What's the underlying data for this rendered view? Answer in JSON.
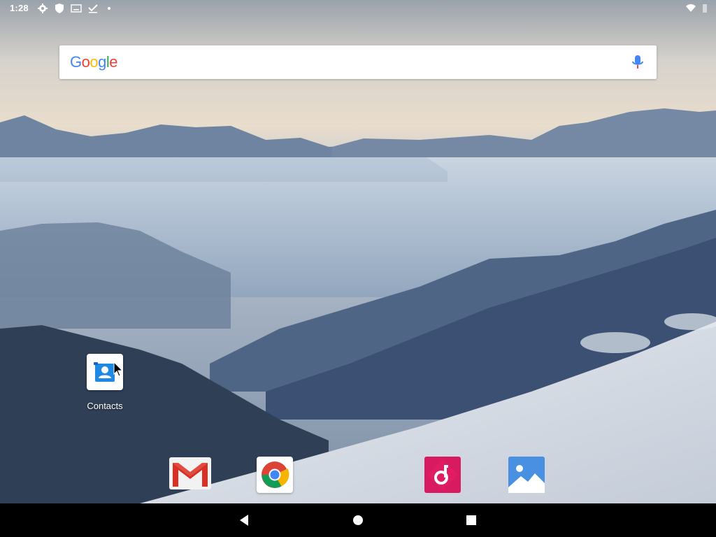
{
  "status_bar": {
    "time": "1:28",
    "icons_left": [
      "settings-icon",
      "shield-icon",
      "keyboard-icon",
      "download-done-icon",
      "dot-icon"
    ],
    "icons_right": [
      "wifi-icon",
      "battery-icon"
    ]
  },
  "search": {
    "logo_letters": [
      {
        "ch": "G",
        "color": "#4285F4"
      },
      {
        "ch": "o",
        "color": "#EA4335"
      },
      {
        "ch": "o",
        "color": "#FBBC05"
      },
      {
        "ch": "g",
        "color": "#4285F4"
      },
      {
        "ch": "l",
        "color": "#34A853"
      },
      {
        "ch": "e",
        "color": "#EA4335"
      }
    ],
    "mic_icon": "mic-icon"
  },
  "desktop": {
    "apps": [
      {
        "label": "Contacts",
        "icon": "contacts-icon"
      }
    ]
  },
  "dock": {
    "apps": [
      {
        "icon": "gmail-icon"
      },
      {
        "icon": "chrome-icon"
      },
      {
        "icon": "music-icon"
      },
      {
        "icon": "gallery-icon"
      }
    ]
  },
  "navigation": {
    "buttons": [
      "back-icon",
      "home-icon",
      "recents-icon"
    ]
  },
  "colors": {
    "navbar": "#000000",
    "contacts_blue": "#1E88E5",
    "music_pink": "#D81B60",
    "gallery_blue": "#4A90E2"
  }
}
